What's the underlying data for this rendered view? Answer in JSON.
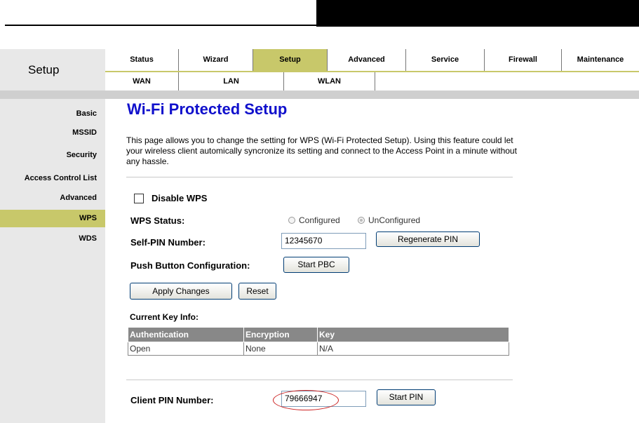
{
  "header": {
    "section_title": "Setup"
  },
  "nav": {
    "primary": [
      "Status",
      "Wizard",
      "Setup",
      "Advanced",
      "Service",
      "Firewall",
      "Maintenance"
    ],
    "primary_selected": "Setup",
    "secondary": [
      "WAN",
      "LAN",
      "WLAN"
    ]
  },
  "sidebar": {
    "items": [
      "Basic",
      "MSSID",
      "Security",
      "Access Control List",
      "Advanced",
      "WPS",
      "WDS"
    ],
    "selected": "WPS"
  },
  "page": {
    "title": "Wi-Fi Protected Setup",
    "description": "This page allows you to change the setting for WPS (Wi-Fi Protected Setup). Using this feature could let your wireless client automically syncronize its setting and connect to the Access Point in a minute without any hassle."
  },
  "wps": {
    "disable_label": "Disable WPS",
    "status_label": "WPS Status:",
    "status_options": [
      "Configured",
      "UnConfigured"
    ],
    "status_selected": "UnConfigured",
    "self_pin_label": "Self-PIN Number:",
    "self_pin_value": "12345670",
    "regenerate_label": "Regenerate PIN",
    "pbc_label": "Push Button Configuration:",
    "start_pbc_label": "Start PBC",
    "apply_label": "Apply Changes",
    "reset_label": "Reset"
  },
  "key_info": {
    "title": "Current Key Info:",
    "columns": [
      "Authentication",
      "Encryption",
      "Key"
    ],
    "rows": [
      [
        "Open",
        "None",
        "N/A"
      ]
    ]
  },
  "client_pin": {
    "label": "Client PIN Number:",
    "value": "79666947",
    "start_label": "Start PIN"
  },
  "colors": {
    "accent": "#c8c86a",
    "title_blue": "#1010cc",
    "highlight_red": "#cc2222"
  }
}
